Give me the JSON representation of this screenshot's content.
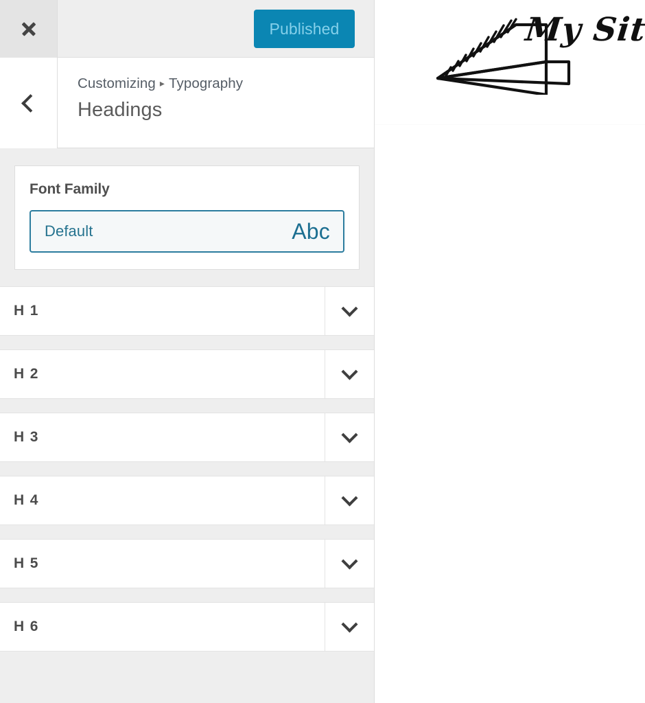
{
  "panel": {
    "topbar": {
      "close_icon": "close-icon",
      "publish_label": "Published"
    },
    "header": {
      "back_icon": "chevron-left-icon",
      "breadcrumb_root": "Customizing",
      "breadcrumb_separator": "▸",
      "breadcrumb_parent": "Typography",
      "section_title": "Headings"
    },
    "font_family": {
      "label": "Font Family",
      "selected_value": "Default",
      "preview_text": "Abc"
    },
    "heading_rows": [
      {
        "label": "H 1",
        "toggle_icon": "chevron-down-icon"
      },
      {
        "label": "H 2",
        "toggle_icon": "chevron-down-icon"
      },
      {
        "label": "H 3",
        "toggle_icon": "chevron-down-icon"
      },
      {
        "label": "H 4",
        "toggle_icon": "chevron-down-icon"
      },
      {
        "label": "H 5",
        "toggle_icon": "chevron-down-icon"
      },
      {
        "label": "H 6",
        "toggle_icon": "chevron-down-icon"
      }
    ]
  },
  "preview": {
    "logo_icon": "paper-plane-logo-icon",
    "site_title": "My Site"
  },
  "colors": {
    "accent_blue": "#0b86b3",
    "publish_text": "#85d0ea",
    "select_border": "#2b7c9e",
    "select_text": "#25738f",
    "panel_background": "#eeeeee",
    "row_background": "#ffffff",
    "label_text": "#4e4e4e",
    "breadcrumb_text": "#555d66",
    "title_text": "#5b5b5b"
  }
}
